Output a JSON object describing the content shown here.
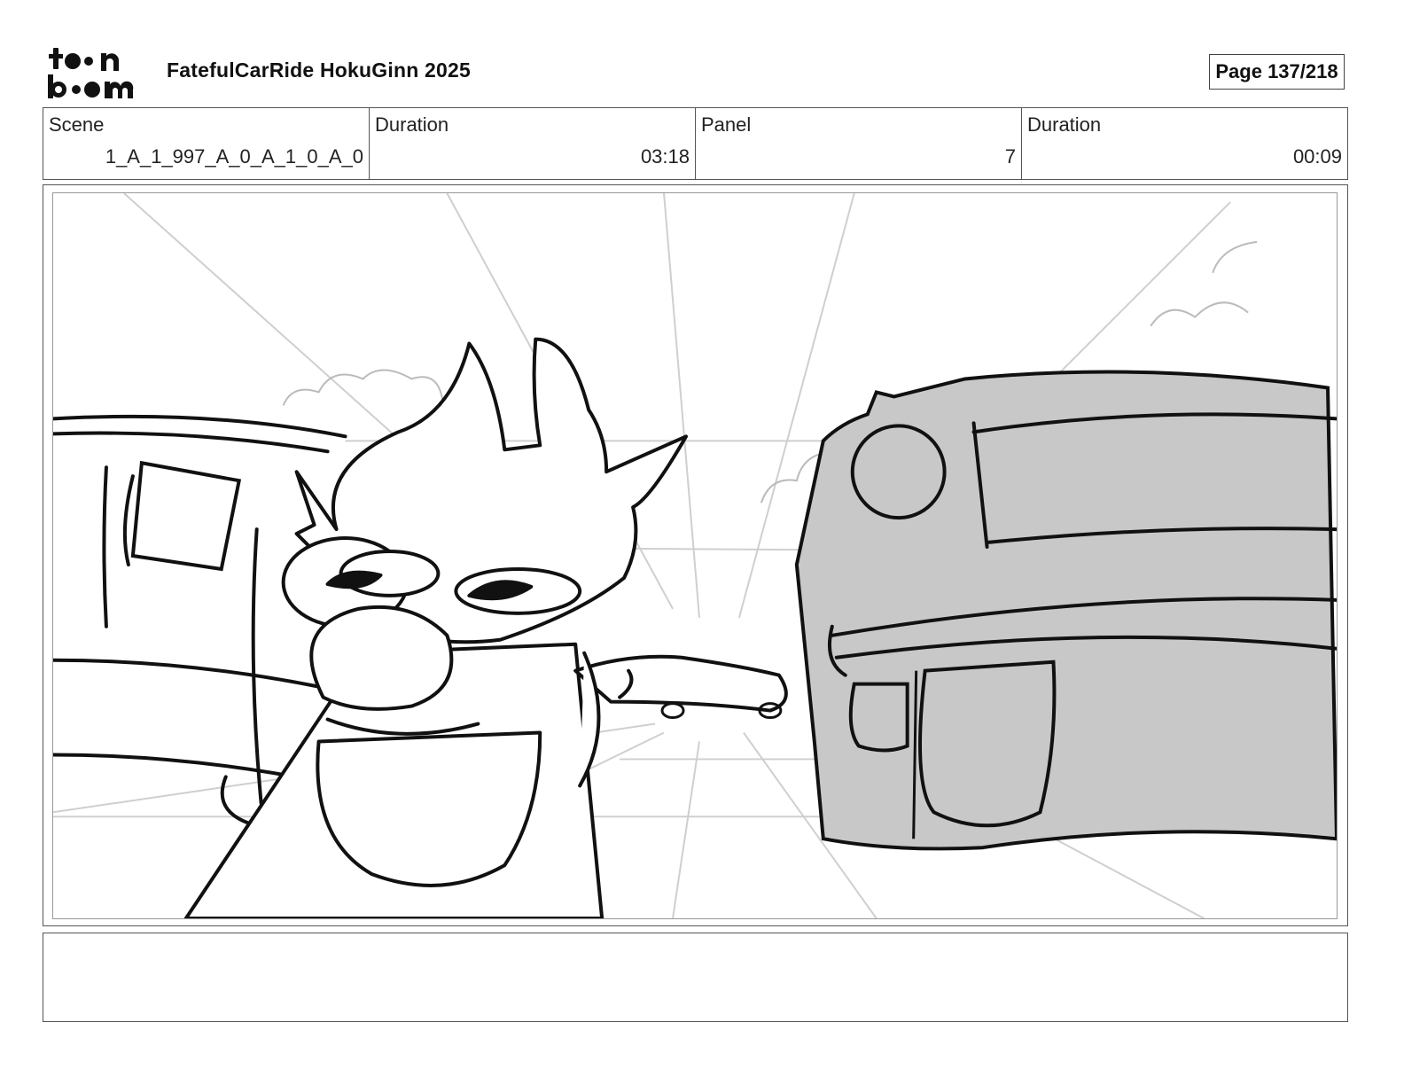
{
  "header": {
    "logo_name": "toon-boom-logo",
    "project_title": "FatefulCarRide HokuGinn 2025",
    "page_indicator": "Page 137/218"
  },
  "info": {
    "scene_label": "Scene",
    "scene_value": "1_A_1_997_A_0_A_1_0_A_0",
    "scene_duration_label": "Duration",
    "scene_duration_value": "03:18",
    "panel_label": "Panel",
    "panel_value": "7",
    "panel_duration_label": "Duration",
    "panel_duration_value": "00:09"
  },
  "panel": {
    "image_description_icon": "storyboard-sketch-creature-between-cars"
  },
  "notes": {
    "text": ""
  },
  "colors": {
    "car_fill": "#c8c8c8",
    "line": "#111111",
    "perspective": "#c9c9c9"
  }
}
